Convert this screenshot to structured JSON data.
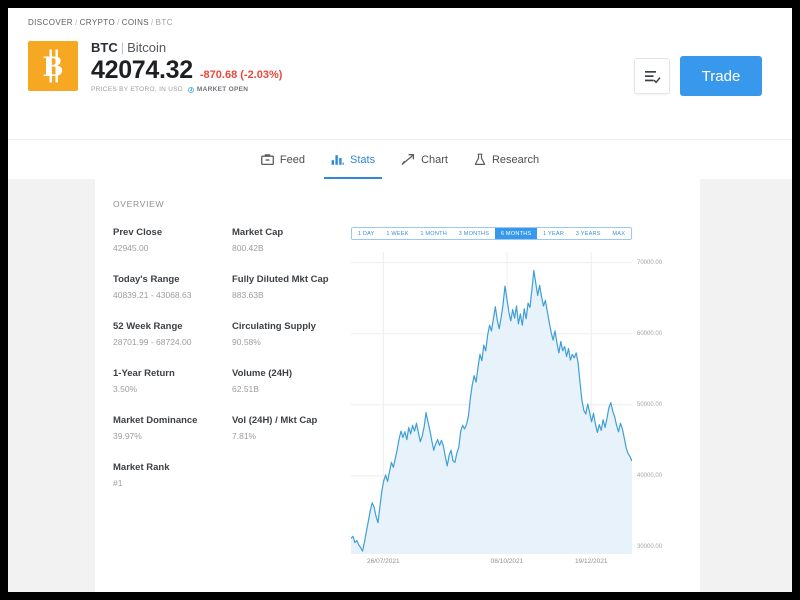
{
  "breadcrumb": {
    "items": [
      "DISCOVER",
      "CRYPTO",
      "COINS",
      "BTC"
    ],
    "separator": "/"
  },
  "hero": {
    "symbol": "BTC",
    "divider": "|",
    "name": "Bitcoin",
    "price": "42074.32",
    "change": "-870.68 (-2.03%)",
    "change_color": "#e8483c",
    "logo_color": "#f7a823",
    "logo_glyph": "bitcoin-b",
    "meta_prices": "PRICES BY ETORO, IN USD",
    "meta_status": "MARKET OPEN"
  },
  "actions": {
    "watchlist_icon": "watchlist-check-icon",
    "trade_label": "Trade",
    "trade_color": "#3899ec"
  },
  "tabs": [
    {
      "label": "Feed",
      "icon": "briefcase-icon",
      "active": false
    },
    {
      "label": "Stats",
      "icon": "bar-chart-icon",
      "active": true
    },
    {
      "label": "Chart",
      "icon": "trending-up-icon",
      "active": false
    },
    {
      "label": "Research",
      "icon": "flask-icon",
      "active": false
    }
  ],
  "overview": {
    "section_label": "OVERVIEW",
    "column_left": [
      {
        "label": "Prev Close",
        "value": "42945.00"
      },
      {
        "label": "Today's Range",
        "value": "40839.21 - 43068.63"
      },
      {
        "label": "52 Week Range",
        "value": "28701.99 - 68724.00"
      },
      {
        "label": "1-Year Return",
        "value": "3.50%"
      },
      {
        "label": "Market Dominance",
        "value": "39.97%"
      },
      {
        "label": "Market Rank",
        "value": "#1"
      }
    ],
    "column_right": [
      {
        "label": "Market Cap",
        "value": "800.42B"
      },
      {
        "label": "Fully Diluted Mkt Cap",
        "value": "883.63B"
      },
      {
        "label": "Circulating Supply",
        "value": "90.58%"
      },
      {
        "label": "Volume (24H)",
        "value": "62.51B"
      },
      {
        "label": "Vol (24H) / Mkt Cap",
        "value": "7.81%"
      }
    ]
  },
  "range_selector": {
    "options": [
      "1 DAY",
      "1 WEEK",
      "1 MONTH",
      "3 MONTHS",
      "6 MONTHS",
      "1 YEAR",
      "3 YEARS",
      "MAX"
    ],
    "selected": "6 MONTHS"
  },
  "chart_data": {
    "type": "area",
    "title": "",
    "xlabel": "",
    "ylabel": "",
    "line_color": "#3e9fd8",
    "fill_color": "#e8f2fa",
    "grid": true,
    "ylim": [
      29000,
      71500
    ],
    "yticks": [
      70000,
      60000,
      50000,
      40000,
      30000
    ],
    "ytick_labels": [
      "70000.00",
      "60000.00",
      "50000.00",
      "40000.00",
      "30000.00"
    ],
    "xticks": [
      "26/07/2021",
      "08/10/2021",
      "19/12/2021"
    ],
    "xtick_positions": [
      0.115,
      0.555,
      0.855
    ],
    "series": [
      {
        "name": "BTC Price (USD)",
        "values": [
          31200,
          31500,
          30600,
          30900,
          30300,
          29900,
          29400,
          30700,
          32200,
          33600,
          35100,
          36200,
          35600,
          34300,
          33400,
          35600,
          37800,
          39300,
          40100,
          39200,
          40600,
          41900,
          41200,
          42400,
          43700,
          45200,
          46300,
          45400,
          46200,
          45100,
          46800,
          45900,
          47100,
          46300,
          47400,
          46100,
          44800,
          45600,
          46900,
          48900,
          47600,
          46400,
          44900,
          43600,
          44500,
          45100,
          44300,
          45000,
          44200,
          42700,
          41400,
          42900,
          43600,
          42100,
          41900,
          43200,
          44000,
          46300,
          47100,
          46600,
          47200,
          48400,
          50900,
          52800,
          54100,
          53200,
          55300,
          57100,
          56200,
          58400,
          57600,
          59800,
          61200,
          60400,
          62100,
          63800,
          61900,
          60700,
          62300,
          64100,
          66700,
          64900,
          63100,
          61800,
          63400,
          62200,
          63900,
          61400,
          62800,
          61200,
          63500,
          62100,
          64300,
          63700,
          66200,
          68900,
          67100,
          65400,
          66800,
          65200,
          63900,
          64700,
          63100,
          61600,
          60200,
          59100,
          60400,
          58700,
          57300,
          58900,
          57600,
          58200,
          56800,
          57900,
          56300,
          57100,
          56600,
          57300,
          55900,
          53100,
          50600,
          49200,
          48700,
          50100,
          48900,
          47600,
          48800,
          47300,
          46100,
          47200,
          46400,
          47900,
          46800,
          48100,
          49600,
          50300,
          49100,
          48300,
          47100,
          46200,
          47400,
          46600,
          45300,
          43900,
          43100,
          42700,
          42074
        ]
      }
    ]
  }
}
